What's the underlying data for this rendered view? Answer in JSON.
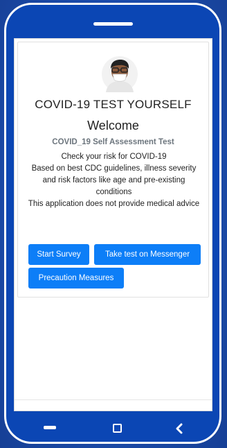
{
  "app": {
    "title": "COVID-19 TEST YOURSELF",
    "welcome": "Welcome",
    "subtitle": "COVID_19 Self Assessment Test",
    "description_lines": [
      "Check your risk for COVID-19",
      "Based on best CDC guidelines, illness severity and risk factors like age and pre-existing conditions",
      "This application does not provide medical advice"
    ]
  },
  "buttons": {
    "start_survey": "Start Survey",
    "messenger": "Take test on Messenger",
    "precaution": "Precaution Measures"
  },
  "colors": {
    "background": "#1d4fb0",
    "phone_frame": "#0b46b4",
    "primary_button": "#0d7ef7"
  },
  "icons": {
    "avatar": "doctor-avatar-icon",
    "nav_back": "nav-back-icon",
    "nav_home": "nav-home-icon",
    "nav_recent": "nav-recent-icon"
  }
}
